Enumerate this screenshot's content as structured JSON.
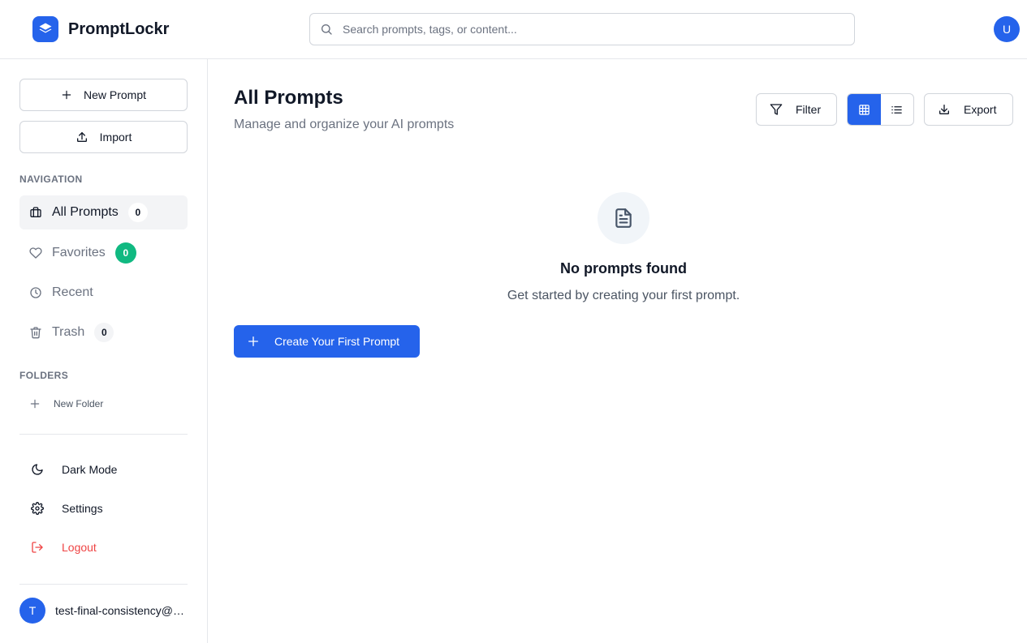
{
  "header": {
    "app_title": "PromptLockr",
    "search_placeholder": "Search prompts, tags, or content...",
    "avatar_initial": "U"
  },
  "sidebar": {
    "new_prompt_label": "New Prompt",
    "import_label": "Import",
    "navigation_heading": "NAVIGATION",
    "nav": {
      "all_prompts": {
        "label": "All Prompts",
        "count": "0"
      },
      "favorites": {
        "label": "Favorites",
        "count": "0"
      },
      "recent": {
        "label": "Recent"
      },
      "trash": {
        "label": "Trash",
        "count": "0"
      }
    },
    "folders_heading": "FOLDERS",
    "new_folder_label": "New Folder",
    "dark_mode_label": "Dark Mode",
    "settings_label": "Settings",
    "logout_label": "Logout",
    "user": {
      "initial": "T",
      "name": "test-final-consistency@example.com"
    }
  },
  "main": {
    "title": "All Prompts",
    "subtitle": "Manage and organize your AI prompts",
    "filter_label": "Filter",
    "export_label": "Export",
    "view_mode": "grid",
    "empty": {
      "icon": "file-text-icon",
      "title": "No prompts found",
      "text": "Get started by creating your first prompt."
    },
    "create_first_label": "Create Your First Prompt"
  },
  "colors": {
    "accent": "#2563eb",
    "favorites_badge": "#10b981",
    "logout": "#ef4444",
    "muted_text": "#6b7280",
    "border": "#e5e7eb"
  }
}
